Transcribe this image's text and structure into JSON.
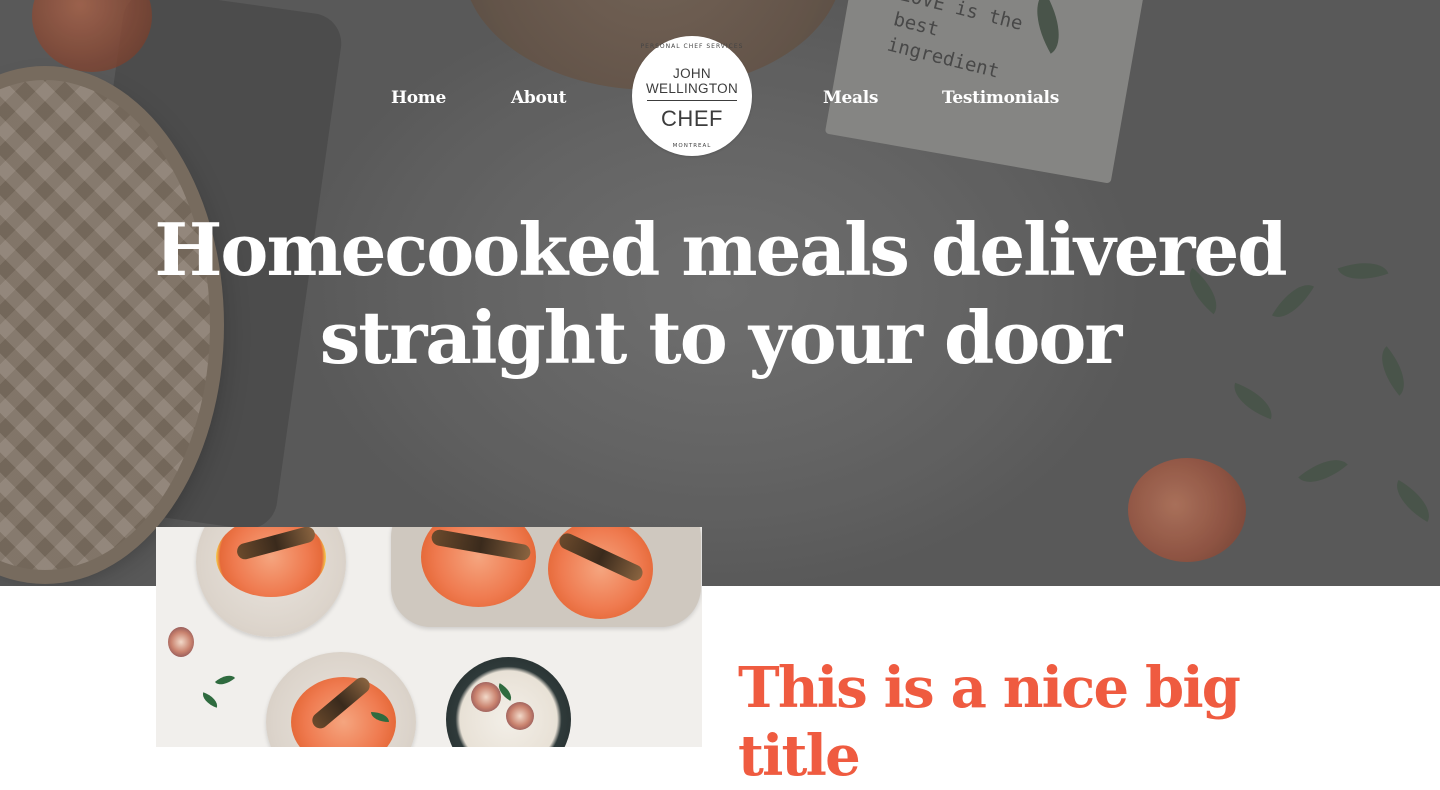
{
  "nav": {
    "items": [
      {
        "label": "Home"
      },
      {
        "label": "About"
      },
      {
        "label": "Meals"
      },
      {
        "label": "Testimonials"
      }
    ]
  },
  "logo": {
    "top_arc": "PERSONAL CHEF SERVICES",
    "name_line1": "JOHN",
    "name_line2": "WELLINGTON",
    "chef": "CHEF",
    "bottom_arc": "MONTREAL"
  },
  "hero": {
    "title": "Homecooked meals delivered straight to your door",
    "napkin_text": "LOVE is the best ingredient"
  },
  "content": {
    "section_title": "This is a nice big title"
  },
  "colors": {
    "accent": "#ef5b40",
    "hero_text": "#ffffff",
    "logo_text": "#3c3c3c"
  }
}
